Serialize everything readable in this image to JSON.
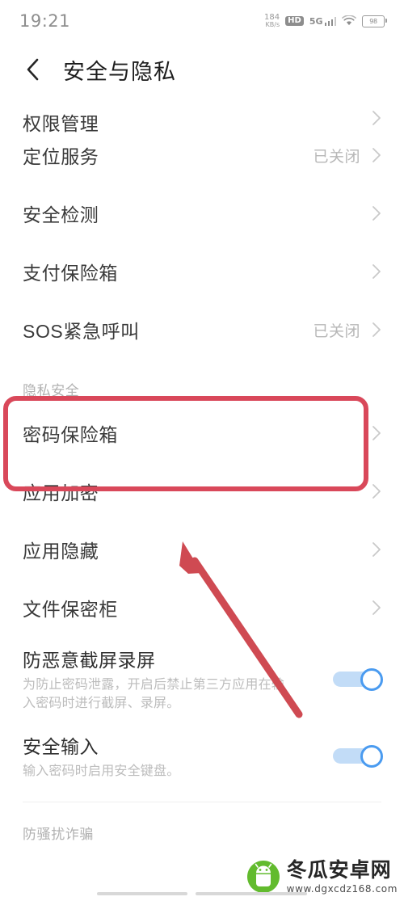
{
  "statusbar": {
    "time": "19:21",
    "net_speed_value": "184",
    "net_speed_unit": "KB/s",
    "hd_label": "HD",
    "network_type": "5G",
    "battery_percent": "98"
  },
  "header": {
    "title": "安全与隐私",
    "back_icon": "chevron-left-icon"
  },
  "list": {
    "rows": [
      {
        "label": "权限管理",
        "value": "",
        "clipped": true
      },
      {
        "label": "定位服务",
        "value": "已关闭",
        "clipped": false
      },
      {
        "label": "安全检测",
        "value": "",
        "clipped": false
      },
      {
        "label": "支付保险箱",
        "value": "",
        "clipped": false
      },
      {
        "label": "SOS紧急呼叫",
        "value": "已关闭",
        "clipped": false
      }
    ],
    "section_title": "隐私安全",
    "rows_after": [
      {
        "label": "密码保险箱",
        "value": ""
      },
      {
        "label": "应用加密",
        "value": ""
      },
      {
        "label": "应用隐藏",
        "value": ""
      },
      {
        "label": "文件保密柜",
        "value": ""
      }
    ],
    "toggles": [
      {
        "title": "防恶意截屏录屏",
        "desc": "为防止密码泄露，开启后禁止第三方应用在输入密码时进行截屏、录屏。",
        "state": "on"
      },
      {
        "title": "安全输入",
        "desc": "输入密码时启用安全键盘。",
        "state": "on"
      }
    ],
    "bottom_section_title": "防骚扰诈骗"
  },
  "annotation": {
    "box_color": "#d9485a",
    "arrow_color": "#cf4a52",
    "box_target": "密码保险箱",
    "arrow_points_to": "密码保险箱"
  },
  "watermark": {
    "name": "冬瓜安卓网",
    "url": "www.dgxcdz168.com",
    "logo_color": "#62bb2e"
  },
  "theme": {
    "accent_on": "#4a9bf0",
    "track_on": "#c2dcf7",
    "text_primary": "#3a3a3a",
    "text_muted": "#b7b7b7",
    "background": "#ffffff"
  }
}
